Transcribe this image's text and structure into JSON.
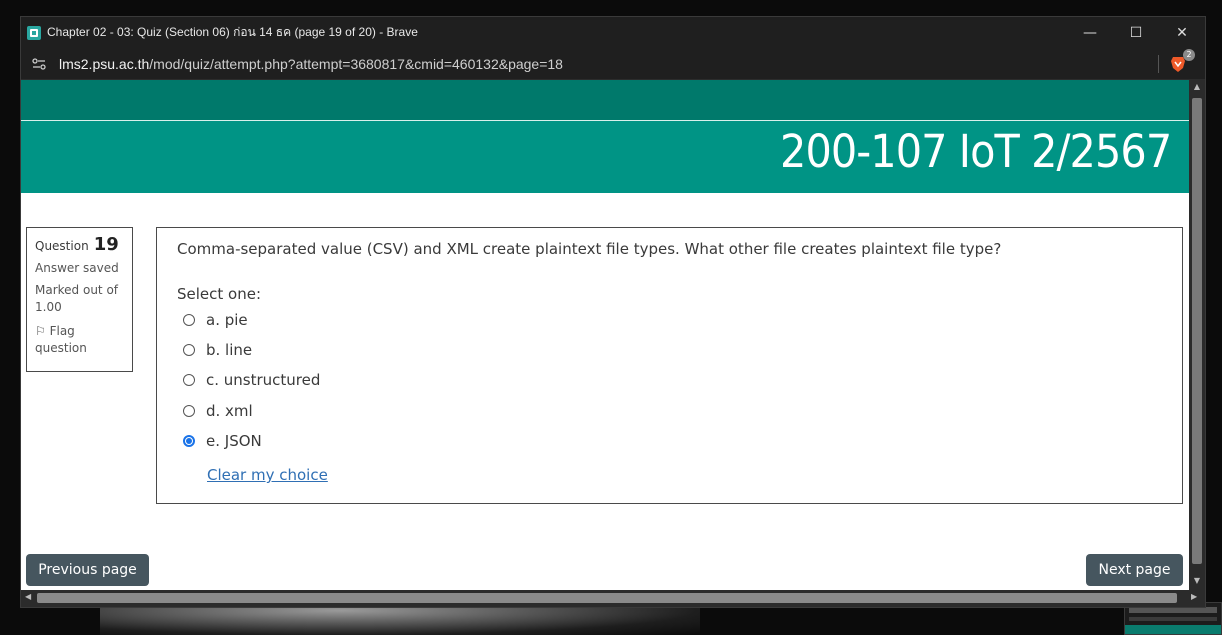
{
  "window": {
    "title": "Chapter 02 - 03: Quiz (Section 06) ก่อน 14 ธค (page 19 of 20) - Brave",
    "minimize": "—",
    "maximize": "☐",
    "close": "✕"
  },
  "address": {
    "host": "lms2.psu.ac.th",
    "path": "/mod/quiz/attempt.php?attempt=3680817&cmid=460132&page=18"
  },
  "brave": {
    "badge": "2"
  },
  "course": {
    "title": "200-107 IoT 2/2567"
  },
  "question_info": {
    "label": "Question",
    "number": "19",
    "status": "Answer saved",
    "marked": "Marked out of 1.00",
    "flag": "Flag question"
  },
  "question": {
    "text": "Comma-separated value (CSV) and XML create plaintext file types. What other file creates plaintext file type?",
    "prompt": "Select one:",
    "options": [
      {
        "label": "a. pie",
        "selected": false
      },
      {
        "label": "b. line",
        "selected": false
      },
      {
        "label": "c. unstructured",
        "selected": false
      },
      {
        "label": "d. xml",
        "selected": false
      },
      {
        "label": "e. JSON",
        "selected": true
      }
    ],
    "clear_label": "Clear my choice"
  },
  "nav": {
    "previous": "Previous page",
    "next": "Next page"
  },
  "colors": {
    "header_dark": "#00796b",
    "header_main": "#009485",
    "button": "#46565f",
    "radio_selected": "#1a73e8"
  }
}
